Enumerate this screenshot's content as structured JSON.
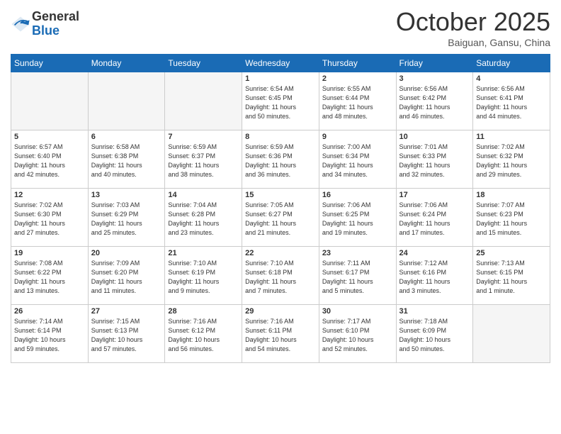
{
  "header": {
    "logo_general": "General",
    "logo_blue": "Blue",
    "month": "October 2025",
    "location": "Baiguan, Gansu, China"
  },
  "weekdays": [
    "Sunday",
    "Monday",
    "Tuesday",
    "Wednesday",
    "Thursday",
    "Friday",
    "Saturday"
  ],
  "weeks": [
    [
      {
        "day": "",
        "info": ""
      },
      {
        "day": "",
        "info": ""
      },
      {
        "day": "",
        "info": ""
      },
      {
        "day": "1",
        "info": "Sunrise: 6:54 AM\nSunset: 6:45 PM\nDaylight: 11 hours\nand 50 minutes."
      },
      {
        "day": "2",
        "info": "Sunrise: 6:55 AM\nSunset: 6:44 PM\nDaylight: 11 hours\nand 48 minutes."
      },
      {
        "day": "3",
        "info": "Sunrise: 6:56 AM\nSunset: 6:42 PM\nDaylight: 11 hours\nand 46 minutes."
      },
      {
        "day": "4",
        "info": "Sunrise: 6:56 AM\nSunset: 6:41 PM\nDaylight: 11 hours\nand 44 minutes."
      }
    ],
    [
      {
        "day": "5",
        "info": "Sunrise: 6:57 AM\nSunset: 6:40 PM\nDaylight: 11 hours\nand 42 minutes."
      },
      {
        "day": "6",
        "info": "Sunrise: 6:58 AM\nSunset: 6:38 PM\nDaylight: 11 hours\nand 40 minutes."
      },
      {
        "day": "7",
        "info": "Sunrise: 6:59 AM\nSunset: 6:37 PM\nDaylight: 11 hours\nand 38 minutes."
      },
      {
        "day": "8",
        "info": "Sunrise: 6:59 AM\nSunset: 6:36 PM\nDaylight: 11 hours\nand 36 minutes."
      },
      {
        "day": "9",
        "info": "Sunrise: 7:00 AM\nSunset: 6:34 PM\nDaylight: 11 hours\nand 34 minutes."
      },
      {
        "day": "10",
        "info": "Sunrise: 7:01 AM\nSunset: 6:33 PM\nDaylight: 11 hours\nand 32 minutes."
      },
      {
        "day": "11",
        "info": "Sunrise: 7:02 AM\nSunset: 6:32 PM\nDaylight: 11 hours\nand 29 minutes."
      }
    ],
    [
      {
        "day": "12",
        "info": "Sunrise: 7:02 AM\nSunset: 6:30 PM\nDaylight: 11 hours\nand 27 minutes."
      },
      {
        "day": "13",
        "info": "Sunrise: 7:03 AM\nSunset: 6:29 PM\nDaylight: 11 hours\nand 25 minutes."
      },
      {
        "day": "14",
        "info": "Sunrise: 7:04 AM\nSunset: 6:28 PM\nDaylight: 11 hours\nand 23 minutes."
      },
      {
        "day": "15",
        "info": "Sunrise: 7:05 AM\nSunset: 6:27 PM\nDaylight: 11 hours\nand 21 minutes."
      },
      {
        "day": "16",
        "info": "Sunrise: 7:06 AM\nSunset: 6:25 PM\nDaylight: 11 hours\nand 19 minutes."
      },
      {
        "day": "17",
        "info": "Sunrise: 7:06 AM\nSunset: 6:24 PM\nDaylight: 11 hours\nand 17 minutes."
      },
      {
        "day": "18",
        "info": "Sunrise: 7:07 AM\nSunset: 6:23 PM\nDaylight: 11 hours\nand 15 minutes."
      }
    ],
    [
      {
        "day": "19",
        "info": "Sunrise: 7:08 AM\nSunset: 6:22 PM\nDaylight: 11 hours\nand 13 minutes."
      },
      {
        "day": "20",
        "info": "Sunrise: 7:09 AM\nSunset: 6:20 PM\nDaylight: 11 hours\nand 11 minutes."
      },
      {
        "day": "21",
        "info": "Sunrise: 7:10 AM\nSunset: 6:19 PM\nDaylight: 11 hours\nand 9 minutes."
      },
      {
        "day": "22",
        "info": "Sunrise: 7:10 AM\nSunset: 6:18 PM\nDaylight: 11 hours\nand 7 minutes."
      },
      {
        "day": "23",
        "info": "Sunrise: 7:11 AM\nSunset: 6:17 PM\nDaylight: 11 hours\nand 5 minutes."
      },
      {
        "day": "24",
        "info": "Sunrise: 7:12 AM\nSunset: 6:16 PM\nDaylight: 11 hours\nand 3 minutes."
      },
      {
        "day": "25",
        "info": "Sunrise: 7:13 AM\nSunset: 6:15 PM\nDaylight: 11 hours\nand 1 minute."
      }
    ],
    [
      {
        "day": "26",
        "info": "Sunrise: 7:14 AM\nSunset: 6:14 PM\nDaylight: 10 hours\nand 59 minutes."
      },
      {
        "day": "27",
        "info": "Sunrise: 7:15 AM\nSunset: 6:13 PM\nDaylight: 10 hours\nand 57 minutes."
      },
      {
        "day": "28",
        "info": "Sunrise: 7:16 AM\nSunset: 6:12 PM\nDaylight: 10 hours\nand 56 minutes."
      },
      {
        "day": "29",
        "info": "Sunrise: 7:16 AM\nSunset: 6:11 PM\nDaylight: 10 hours\nand 54 minutes."
      },
      {
        "day": "30",
        "info": "Sunrise: 7:17 AM\nSunset: 6:10 PM\nDaylight: 10 hours\nand 52 minutes."
      },
      {
        "day": "31",
        "info": "Sunrise: 7:18 AM\nSunset: 6:09 PM\nDaylight: 10 hours\nand 50 minutes."
      },
      {
        "day": "",
        "info": ""
      }
    ]
  ]
}
